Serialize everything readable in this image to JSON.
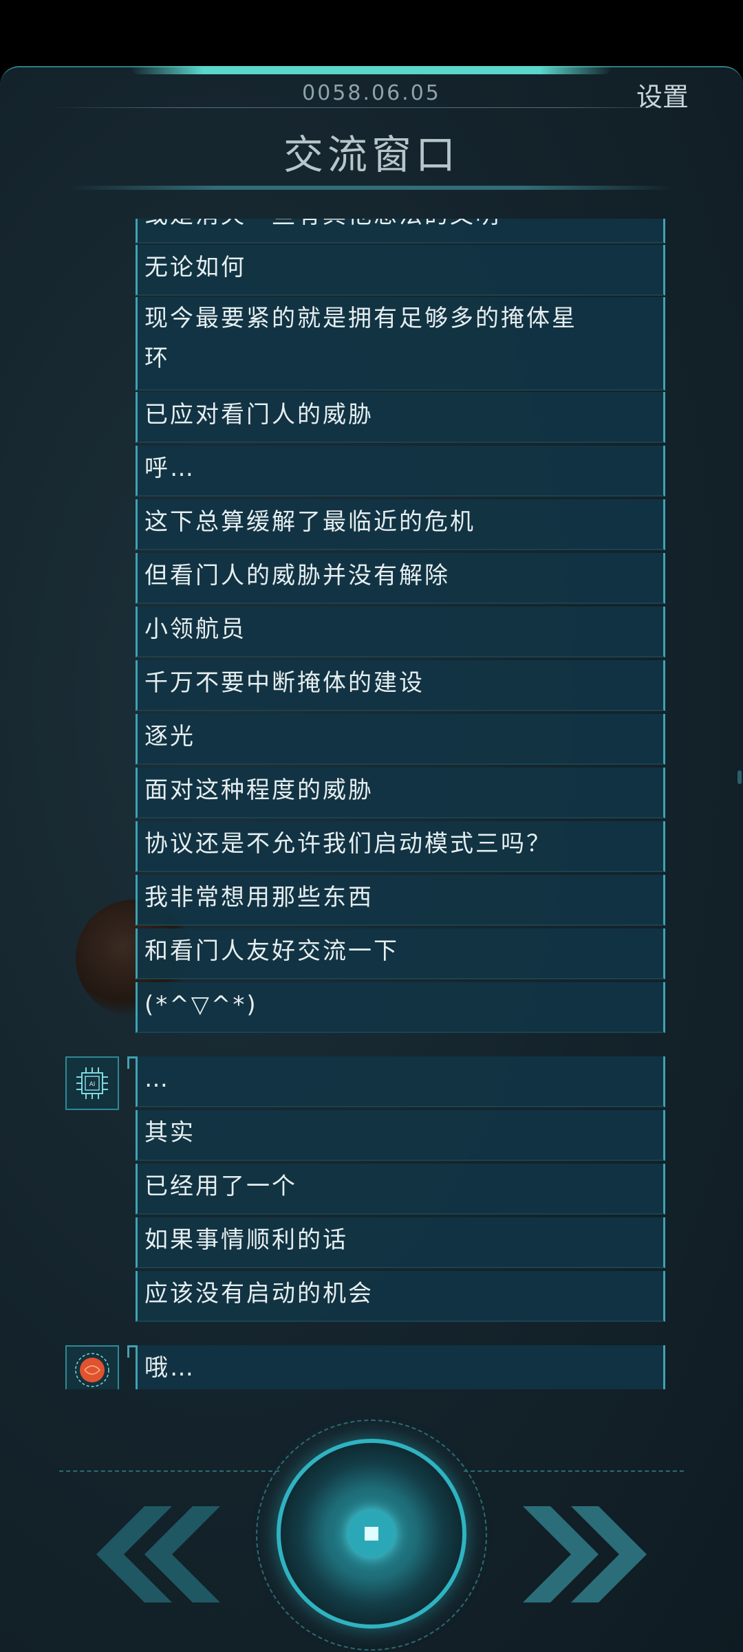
{
  "header": {
    "date": "0058.06.05",
    "settings_label": "设置",
    "title": "交流窗口"
  },
  "messages": [
    {
      "speaker": "player",
      "text": "或是消灭一些有其他想法的文明"
    },
    {
      "speaker": "player",
      "text": "无论如何"
    },
    {
      "speaker": "player",
      "line1": "现今最要紧的就是拥有足够多的掩体星",
      "line2": "环"
    },
    {
      "speaker": "player",
      "text": "已应对看门人的威胁"
    },
    {
      "speaker": "player",
      "text": "呼…"
    },
    {
      "speaker": "player",
      "text": "这下总算缓解了最临近的危机"
    },
    {
      "speaker": "player",
      "text": "但看门人的威胁并没有解除"
    },
    {
      "speaker": "player",
      "text": "小领航员"
    },
    {
      "speaker": "player",
      "text": "千万不要中断掩体的建设"
    },
    {
      "speaker": "player",
      "text": "逐光"
    },
    {
      "speaker": "player",
      "text": "面对这种程度的威胁"
    },
    {
      "speaker": "player",
      "text": "协议还是不允许我们启动模式三吗？"
    },
    {
      "speaker": "player",
      "text": "我非常想用那些东西"
    },
    {
      "speaker": "player",
      "text": "和看门人友好交流一下"
    },
    {
      "speaker": "player",
      "text": "(*^▽^*)"
    },
    {
      "speaker": "ai",
      "avatar": "AI",
      "text": "…"
    },
    {
      "speaker": "ai",
      "text": "其实"
    },
    {
      "speaker": "ai",
      "text": "已经用了一个"
    },
    {
      "speaker": "ai",
      "text": "如果事情顺利的话"
    },
    {
      "speaker": "ai",
      "text": "应该没有启动的机会"
    },
    {
      "speaker": "pilot",
      "avatar": "brain-icon",
      "text": "哦…"
    }
  ],
  "controls": {
    "back_icon": "double-chevron-left-icon",
    "play_icon": "center-action-icon",
    "forward_icon": "double-chevron-right-icon"
  },
  "colors": {
    "accent": "#3fa3b3",
    "bubble": "#113444",
    "glow": "#5ad6cb"
  }
}
